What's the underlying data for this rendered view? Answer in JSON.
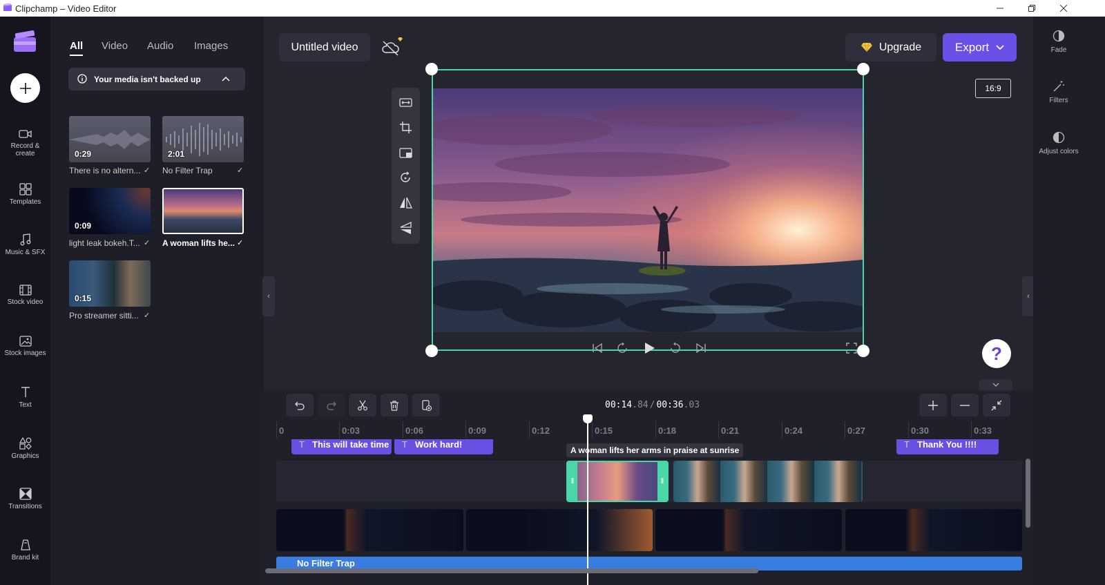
{
  "window": {
    "title": "Clipchamp – Video Editor"
  },
  "left_rail": {
    "items": [
      {
        "label": "Record &",
        "label2": "create",
        "icon": "camera-icon"
      },
      {
        "label": "Templates",
        "icon": "templates-icon"
      },
      {
        "label": "Music & SFX",
        "icon": "music-icon"
      },
      {
        "label": "Stock video",
        "icon": "film-icon"
      },
      {
        "label": "Stock images",
        "icon": "image-icon"
      },
      {
        "label": "Text",
        "icon": "text-icon"
      },
      {
        "label": "Graphics",
        "icon": "shapes-icon"
      },
      {
        "label": "Transitions",
        "icon": "transitions-icon"
      },
      {
        "label": "Brand kit",
        "icon": "brand-icon"
      }
    ]
  },
  "media": {
    "tabs": [
      "All",
      "Video",
      "Audio",
      "Images"
    ],
    "backup_notice": "Your media isn't backed up",
    "items": [
      {
        "duration": "0:29",
        "name": "There is no altern...",
        "checked": "✓"
      },
      {
        "duration": "2:01",
        "name": "No Filter Trap",
        "checked": "✓"
      },
      {
        "duration": "0:09",
        "name": "light leak bokeh.T...",
        "checked": "✓"
      },
      {
        "duration": "",
        "name": "A woman lifts he...",
        "checked": "✓"
      },
      {
        "duration": "0:15",
        "name": "Pro streamer sitti...",
        "checked": "✓"
      }
    ]
  },
  "header": {
    "project_title": "Untitled video",
    "upgrade_label": "Upgrade",
    "export_label": "Export",
    "aspect_ratio": "16:9"
  },
  "right_rail": {
    "items": [
      {
        "label": "Fade",
        "icon": "fade-icon"
      },
      {
        "label": "Filters",
        "icon": "magic-wand-icon"
      },
      {
        "label": "Adjust colors",
        "icon": "contrast-icon"
      }
    ]
  },
  "help": {
    "label": "?"
  },
  "timeline": {
    "current_time": "00:14",
    "current_frac": ".84",
    "separator": "/",
    "total_time": "00:36",
    "total_frac": ".03",
    "ruler_ticks": [
      "0",
      "0:03",
      "0:06",
      "0:09",
      "0:12",
      "0:15",
      "0:18",
      "0:21",
      "0:24",
      "0:27",
      "0:30",
      "0:33"
    ],
    "text_clips": [
      "This will take time",
      "Work hard!",
      "Thank You !!!!"
    ],
    "clip_tooltip": "A woman lifts her arms in praise at sunrise",
    "audio_clip_label": "No Filter Trap"
  },
  "colors": {
    "accent": "#6a50e6",
    "selection": "#4bd6a8",
    "audio": "#3a7de0"
  }
}
